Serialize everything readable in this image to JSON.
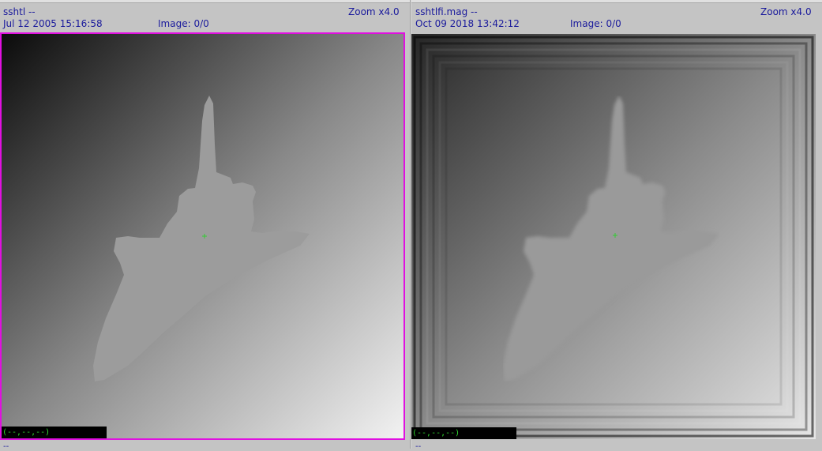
{
  "left_viewer": {
    "title": "sshtl --",
    "zoom": "Zoom x4.0",
    "timestamp": "Jul 12 2005 15:16:58",
    "image_label": "Image: 0/0",
    "coord_readout": "(--,--,--)",
    "footer": "--"
  },
  "right_viewer": {
    "title": "sshtlfi.mag --",
    "zoom": "Zoom x4.0",
    "timestamp": "Oct 09 2018 13:42:12",
    "image_label": "Image: 0/0",
    "coord_readout": "(--,--,--)",
    "footer": "--"
  },
  "colors": {
    "header_text": "#1a1a9c",
    "active_border": "#e010e0",
    "readout_text": "#2fd82f",
    "cursor_marker": "#33cc33"
  }
}
